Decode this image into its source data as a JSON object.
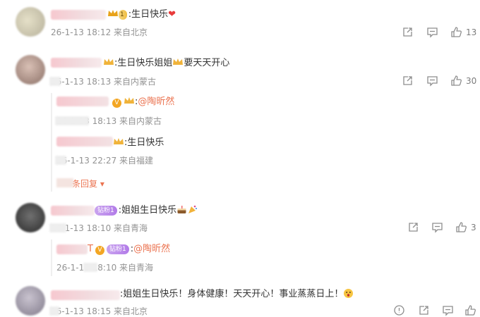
{
  "comments": [
    {
      "text": ":生日快乐",
      "emoji": "heart",
      "level_badge": "1",
      "meta": "26-1-13 18:12 来自北京",
      "like_count": "13",
      "replies": []
    },
    {
      "text": ":生日快乐姐姐",
      "text_suffix": "要天天开心",
      "meta": "26-1-13 18:13 来自内蒙古",
      "like_count": "30",
      "replies": [
        {
          "text": ":",
          "mention": "@陶昕然",
          "meta": "26-1-13 18:13 来自内蒙古"
        },
        {
          "text": ":生日快乐",
          "meta": "26-1-13 22:27 来自福建"
        }
      ],
      "more_replies": "条回复"
    },
    {
      "text": ":姐姐生日快乐",
      "diamond_badge": "钻粉1",
      "meta": "26-1-13 18:10 来自青海",
      "like_count": "3",
      "replies": [
        {
          "name_suffix": "T",
          "diamond_badge": "钻粉1",
          "text": ":",
          "mention": "@陶昕然",
          "meta": "26-1-13 18:10 来自青海"
        }
      ]
    },
    {
      "text": ":姐姐生日快乐！身体健康！天天开心！事业蒸蒸日上！",
      "meta": "26-1-13 18:15 来自北京",
      "replies": []
    }
  ],
  "icons": {
    "share": "share-icon",
    "comment": "comment-icon",
    "like": "like-icon",
    "report": "report-icon"
  },
  "colors": {
    "mention": "#eb7350",
    "meta": "#939393",
    "heart": "#e83b3b"
  }
}
